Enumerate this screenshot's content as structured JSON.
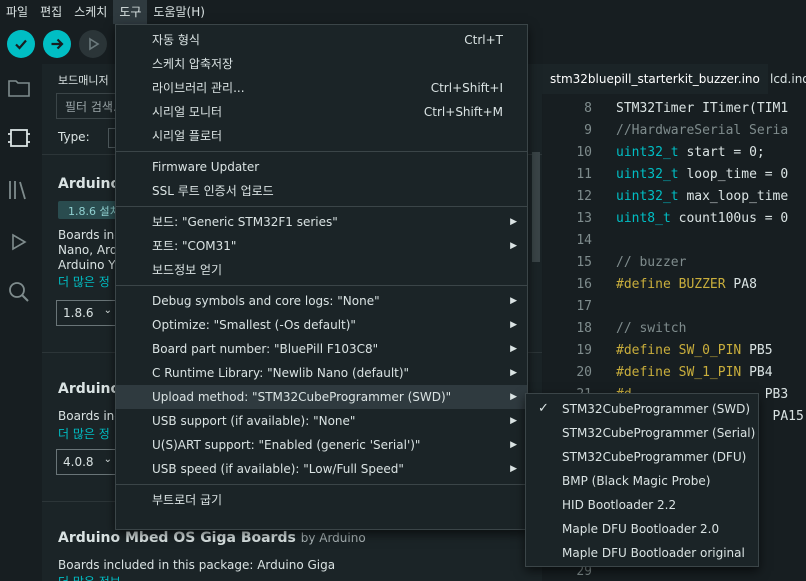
{
  "menubar": {
    "items": [
      "파일",
      "편집",
      "스케치",
      "도구",
      "도움말(H)"
    ],
    "active_index": 3
  },
  "toolbar": {
    "verify": "verify-icon",
    "upload": "upload-icon",
    "debug": "debug-icon"
  },
  "boards_manager": {
    "title": "보드매니저",
    "filter_placeholder": "필터 검색...",
    "type_label": "Type:",
    "boards": [
      {
        "name": "Arduino",
        "installed": "1.8.6 설치",
        "desc": [
          "Boards inc",
          "Nano, Ard",
          "Arduino Yu"
        ],
        "more": "더 많은 정",
        "version": "1.8.6"
      },
      {
        "name": "Arduino",
        "desc": [
          "Boards inc"
        ],
        "more": "더 많은 정",
        "version": "4.0.8"
      },
      {
        "name": "Arduino Mbed OS Giga Boards",
        "by": "by Arduino",
        "desc": [
          "Boards included in this package: Arduino Giga"
        ],
        "more": "더 많은 정보"
      }
    ]
  },
  "editor": {
    "tabs": [
      "stm32bluepill_starterkit_buzzer.ino",
      "lcd.ino"
    ],
    "lines": [
      {
        "n": "8",
        "parts": [
          [
            "cls",
            "STM32Timer ITimer(TIM1"
          ]
        ]
      },
      {
        "n": "9",
        "parts": [
          [
            "comment",
            "//HardwareSerial Seria"
          ]
        ]
      },
      {
        "n": "10",
        "parts": [
          [
            "type",
            "uint32_t"
          ],
          [
            "cls",
            " start = 0;"
          ]
        ]
      },
      {
        "n": "11",
        "parts": [
          [
            "type",
            "uint32_t"
          ],
          [
            "cls",
            " loop_time = 0"
          ]
        ]
      },
      {
        "n": "12",
        "parts": [
          [
            "type",
            "uint32_t"
          ],
          [
            "cls",
            " max_loop_time"
          ]
        ]
      },
      {
        "n": "13",
        "parts": [
          [
            "type",
            "uint8_t"
          ],
          [
            "cls",
            " count100us = 0"
          ]
        ]
      },
      {
        "n": "14",
        "parts": []
      },
      {
        "n": "15",
        "parts": [
          [
            "comment",
            "// buzzer"
          ]
        ]
      },
      {
        "n": "16",
        "parts": [
          [
            "pre",
            "#define"
          ],
          [
            "cls",
            " "
          ],
          [
            "pre",
            "BUZZER"
          ],
          [
            "cls",
            " PA8"
          ]
        ]
      },
      {
        "n": "17",
        "parts": []
      },
      {
        "n": "18",
        "parts": [
          [
            "comment",
            "// switch"
          ]
        ]
      },
      {
        "n": "19",
        "parts": [
          [
            "pre",
            "#define"
          ],
          [
            "cls",
            " "
          ],
          [
            "pre",
            "SW_0_PIN"
          ],
          [
            "cls",
            " PB5"
          ]
        ]
      },
      {
        "n": "20",
        "parts": [
          [
            "pre",
            "#define"
          ],
          [
            "cls",
            " "
          ],
          [
            "pre",
            "SW_1_PIN"
          ],
          [
            "cls",
            " PB4"
          ]
        ]
      },
      {
        "n": "21",
        "parts": [
          [
            "pre",
            "#d"
          ],
          [
            "cls",
            "                 PB3"
          ]
        ]
      },
      {
        "n": "22",
        "parts": [
          [
            "cls",
            "                    PA15"
          ]
        ]
      },
      {
        "n": "29",
        "parts": []
      }
    ]
  },
  "tools_menu": {
    "groups": [
      [
        {
          "label": "자동 형식",
          "shortcut": "Ctrl+T"
        },
        {
          "label": "스케치 압축저장",
          "shortcut": ""
        },
        {
          "label": "라이브러리 관리...",
          "shortcut": "Ctrl+Shift+I"
        },
        {
          "label": "시리얼 모니터",
          "shortcut": "Ctrl+Shift+M"
        },
        {
          "label": "시리얼 플로터",
          "shortcut": ""
        }
      ],
      [
        {
          "label": "Firmware Updater",
          "shortcut": ""
        },
        {
          "label": "SSL 루트 인증서 업로드",
          "shortcut": ""
        }
      ],
      [
        {
          "label": "보드: \"Generic STM32F1 series\"",
          "submenu": true
        },
        {
          "label": "포트: \"COM31\"",
          "submenu": true
        },
        {
          "label": "보드정보 얻기",
          "submenu": false
        }
      ],
      [
        {
          "label": "Debug symbols and core logs: \"None\"",
          "submenu": true
        },
        {
          "label": "Optimize: \"Smallest (-Os default)\"",
          "submenu": true
        },
        {
          "label": "Board part number: \"BluePill F103C8\"",
          "submenu": true
        },
        {
          "label": "C Runtime Library: \"Newlib Nano (default)\"",
          "submenu": true
        },
        {
          "label": "Upload method: \"STM32CubeProgrammer (SWD)\"",
          "submenu": true,
          "highlighted": true
        },
        {
          "label": "USB support (if available): \"None\"",
          "submenu": true
        },
        {
          "label": "U(S)ART support: \"Enabled (generic 'Serial')\"",
          "submenu": true
        },
        {
          "label": "USB speed (if available): \"Low/Full Speed\"",
          "submenu": true
        }
      ],
      [
        {
          "label": "부트로더 굽기",
          "shortcut": ""
        }
      ]
    ]
  },
  "upload_submenu": {
    "items": [
      {
        "label": "STM32CubeProgrammer (SWD)",
        "checked": true
      },
      {
        "label": "STM32CubeProgrammer (Serial)",
        "checked": false
      },
      {
        "label": "STM32CubeProgrammer (DFU)",
        "checked": false
      },
      {
        "label": "BMP (Black Magic Probe)",
        "checked": false
      },
      {
        "label": "HID Bootloader 2.2",
        "checked": false
      },
      {
        "label": "Maple DFU Bootloader 2.0",
        "checked": false
      },
      {
        "label": "Maple DFU Bootloader original",
        "checked": false
      }
    ]
  },
  "colors": {
    "accent": "#00bec4",
    "background": "#171e21",
    "panel": "#1b2427",
    "preprocessor": "#c9ae3c"
  }
}
